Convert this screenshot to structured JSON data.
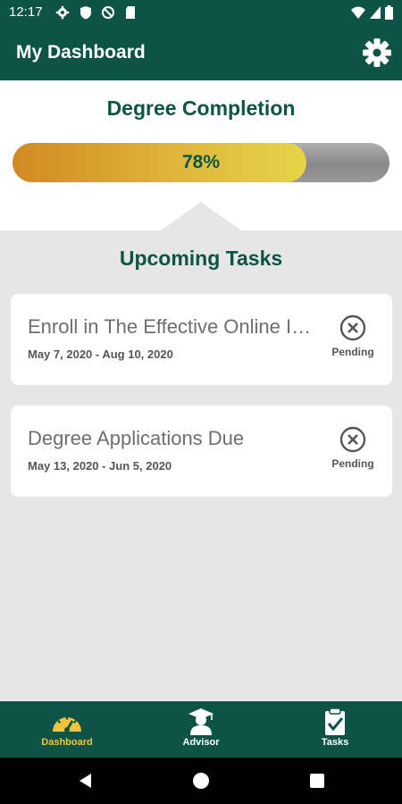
{
  "status_bar": {
    "time": "12:17",
    "left_icons": [
      "gear-icon",
      "shield-icon",
      "blocked-icon",
      "sd-card-icon"
    ],
    "right_icons": [
      "wifi-icon",
      "signal-icon",
      "battery-icon"
    ]
  },
  "app_bar": {
    "title": "My Dashboard",
    "settings_icon": "gear-icon"
  },
  "degree": {
    "title": "Degree Completion",
    "progress_percent": 78,
    "progress_label": "78%"
  },
  "tasks_section": {
    "title": "Upcoming Tasks",
    "tasks": [
      {
        "title": "Enroll in The Effective Online Instructor",
        "dates": "May 7, 2020 - Aug 10, 2020",
        "status": "Pending"
      },
      {
        "title": "Degree Applications Due",
        "dates": "May 13, 2020 - Jun 5, 2020",
        "status": "Pending"
      }
    ]
  },
  "bottom_nav": {
    "items": [
      {
        "label": "Dashboard",
        "icon": "speedometer-icon",
        "active": true
      },
      {
        "label": "Advisor",
        "icon": "graduate-icon",
        "active": false
      },
      {
        "label": "Tasks",
        "icon": "clipboard-check-icon",
        "active": false
      }
    ]
  },
  "colors": {
    "primary": "#0d5446",
    "accent": "#f2c43d",
    "background": "#e6e6e6"
  }
}
